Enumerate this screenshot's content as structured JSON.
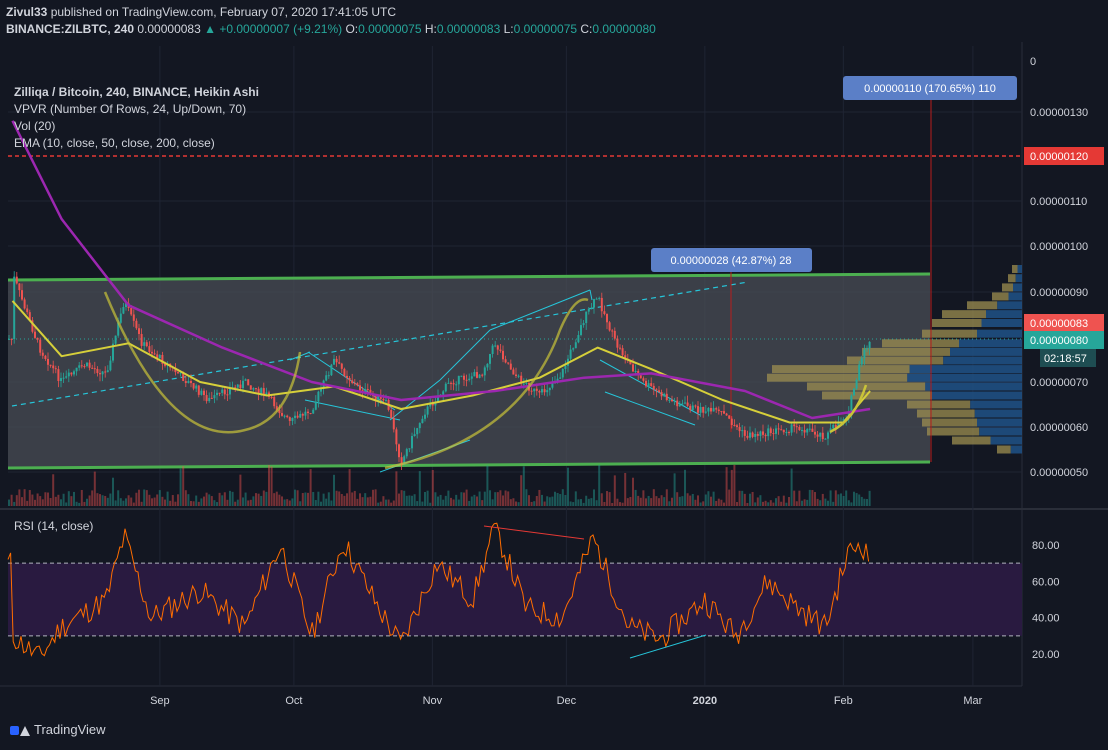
{
  "header": {
    "publisher": "Zivul33",
    "published_text": "published on TradingView.com, February 07, 2020 17:41:05 UTC",
    "symbol": "BINANCE:ZILBTC, 240",
    "last": "0.00000083",
    "change": "+0.00000007 (+9.21%)",
    "o_label": "O:",
    "o": "0.00000075",
    "h_label": "H:",
    "h": "0.00000083",
    "l_label": "L:",
    "l": "0.00000075",
    "c_label": "C:",
    "c": "0.00000080"
  },
  "legend": {
    "title": "Zilliqa / Bitcoin, 240, BINANCE, Heikin Ashi",
    "vpvr": "VPVR (Number Of Rows, 24, Up/Down, 70)",
    "vol": "Vol (20)",
    "ema": "EMA (10, close, 50, close, 200, close)"
  },
  "rsi_label": "RSI (14, close)",
  "annotations": {
    "measure_big": "0.00000110 (170.65%) 110",
    "measure_small": "0.00000028 (42.87%) 28"
  },
  "price_axis": {
    "ticks": [
      "0.00000130",
      "0.00000110",
      "0.00000100",
      "0.00000090",
      "0.00000070",
      "0.00000060",
      "0.00000050"
    ],
    "top_label": "0",
    "label_red": "0.00000120",
    "label_current_red": "0.00000083",
    "label_current_teal": "0.00000080",
    "countdown": "02:18:57"
  },
  "rsi_axis": {
    "ticks": [
      "80.00",
      "60.00",
      "40.00",
      "20.00"
    ]
  },
  "time_axis": {
    "ticks": [
      "Sep",
      "Oct",
      "Nov",
      "Dec",
      "2020",
      "Feb",
      "Mar"
    ]
  },
  "footer": {
    "brand": "TradingView"
  },
  "colors": {
    "background": "#131722",
    "up": "#26a69a",
    "down": "#ef5350",
    "ema_fast": "#d6cf3a",
    "ema_slow": "#9c27b0",
    "channel": "#4caf50",
    "rsi": "#ff6d00",
    "rsi_band": "#2a1a42",
    "trendline": "#26c6da",
    "red_level": "#e53935"
  },
  "chart_data": {
    "type": "candlestick",
    "ylim": [
      4.5e-07,
      1.36e-06
    ],
    "x_range": [
      "2020-07-29",
      "2020-03-12"
    ],
    "price_path": [
      [
        "2019-07-30",
        9.4e-07
      ],
      [
        "2019-08-05",
        7.8e-07
      ],
      [
        "2019-08-10",
        7e-07
      ],
      [
        "2019-08-15",
        7.4e-07
      ],
      [
        "2019-08-20",
        7.2e-07
      ],
      [
        "2019-08-24",
        8.8e-07
      ],
      [
        "2019-08-28",
        7.9e-07
      ],
      [
        "2019-09-05",
        7.2e-07
      ],
      [
        "2019-09-12",
        6.6e-07
      ],
      [
        "2019-09-20",
        7e-07
      ],
      [
        "2019-09-25",
        6.7e-07
      ],
      [
        "2019-09-30",
        6.1e-07
      ],
      [
        "2019-10-05",
        6.4e-07
      ],
      [
        "2019-10-10",
        7.5e-07
      ],
      [
        "2019-10-15",
        6.9e-07
      ],
      [
        "2019-10-22",
        6.5e-07
      ],
      [
        "2019-10-25",
        5.2e-07
      ],
      [
        "2019-10-30",
        6.3e-07
      ],
      [
        "2019-11-05",
        7e-07
      ],
      [
        "2019-11-12",
        7.2e-07
      ],
      [
        "2019-11-15",
        7.9e-07
      ],
      [
        "2019-11-20",
        7.1e-07
      ],
      [
        "2019-11-25",
        6.7e-07
      ],
      [
        "2019-11-30",
        7.2e-07
      ],
      [
        "2019-12-05",
        8.4e-07
      ],
      [
        "2019-12-08",
        8.9e-07
      ],
      [
        "2019-12-12",
        7.9e-07
      ],
      [
        "2019-12-18",
        7e-07
      ],
      [
        "2019-12-24",
        6.6e-07
      ],
      [
        "2019-12-30",
        6.4e-07
      ],
      [
        "2020-01-05",
        6.3e-07
      ],
      [
        "2020-01-10",
        5.8e-07
      ],
      [
        "2020-01-16",
        5.9e-07
      ],
      [
        "2020-01-22",
        6e-07
      ],
      [
        "2020-01-28",
        5.8e-07
      ],
      [
        "2020-02-02",
        6.3e-07
      ],
      [
        "2020-02-05",
        7.5e-07
      ],
      [
        "2020-02-07",
        8e-07
      ]
    ],
    "ema_50_path": [
      [
        "2019-07-30",
        8.8e-07
      ],
      [
        "2019-08-10",
        7.6e-07
      ],
      [
        "2019-08-25",
        7.9e-07
      ],
      [
        "2019-09-10",
        7e-07
      ],
      [
        "2019-09-25",
        6.7e-07
      ],
      [
        "2019-10-10",
        6.9e-07
      ],
      [
        "2019-10-25",
        6.4e-07
      ],
      [
        "2019-11-10",
        6.7e-07
      ],
      [
        "2019-11-25",
        7.1e-07
      ],
      [
        "2019-12-08",
        7.8e-07
      ],
      [
        "2019-12-20",
        7.3e-07
      ],
      [
        "2020-01-05",
        6.6e-07
      ],
      [
        "2020-01-20",
        6.1e-07
      ],
      [
        "2020-02-01",
        6.1e-07
      ],
      [
        "2020-02-07",
        6.8e-07
      ]
    ],
    "ema_200_path": [
      [
        "2019-07-30",
        1.28e-06
      ],
      [
        "2019-08-10",
        1.06e-06
      ],
      [
        "2019-08-25",
        8.7e-07
      ],
      [
        "2019-09-15",
        7.8e-07
      ],
      [
        "2019-10-05",
        7e-07
      ],
      [
        "2019-10-25",
        6.6e-07
      ],
      [
        "2019-11-15",
        6.8e-07
      ],
      [
        "2019-12-05",
        7.1e-07
      ],
      [
        "2019-12-20",
        7.2e-07
      ],
      [
        "2020-01-10",
        6.8e-07
      ],
      [
        "2020-01-25",
        6.2e-07
      ],
      [
        "2020-02-07",
        6.4e-07
      ]
    ],
    "channel": {
      "upper": 9.3e-07,
      "lower": 5.05e-07
    },
    "resistance_level": 1.2e-06,
    "current_price": 8e-07,
    "rsi": {
      "overbought": 70,
      "oversold": 30,
      "ylim": [
        5,
        95
      ],
      "path": [
        [
          "2019-07-30",
          30
        ],
        [
          "2019-08-05",
          18
        ],
        [
          "2019-08-10",
          35
        ],
        [
          "2019-08-20",
          50
        ],
        [
          "2019-08-24",
          85
        ],
        [
          "2019-08-30",
          40
        ],
        [
          "2019-09-10",
          55
        ],
        [
          "2019-09-20",
          35
        ],
        [
          "2019-09-28",
          80
        ],
        [
          "2019-10-05",
          30
        ],
        [
          "2019-10-12",
          82
        ],
        [
          "2019-10-20",
          45
        ],
        [
          "2019-10-25",
          25
        ],
        [
          "2019-11-02",
          70
        ],
        [
          "2019-11-10",
          50
        ],
        [
          "2019-11-15",
          90
        ],
        [
          "2019-11-22",
          45
        ],
        [
          "2019-11-30",
          40
        ],
        [
          "2019-12-04",
          65
        ],
        [
          "2019-12-07",
          84
        ],
        [
          "2019-12-15",
          35
        ],
        [
          "2019-12-22",
          28
        ],
        [
          "2020-01-01",
          50
        ],
        [
          "2020-01-08",
          30
        ],
        [
          "2020-01-15",
          60
        ],
        [
          "2020-01-22",
          45
        ],
        [
          "2020-01-28",
          35
        ],
        [
          "2020-02-02",
          75
        ],
        [
          "2020-02-05",
          82
        ],
        [
          "2020-02-07",
          70
        ]
      ]
    }
  }
}
